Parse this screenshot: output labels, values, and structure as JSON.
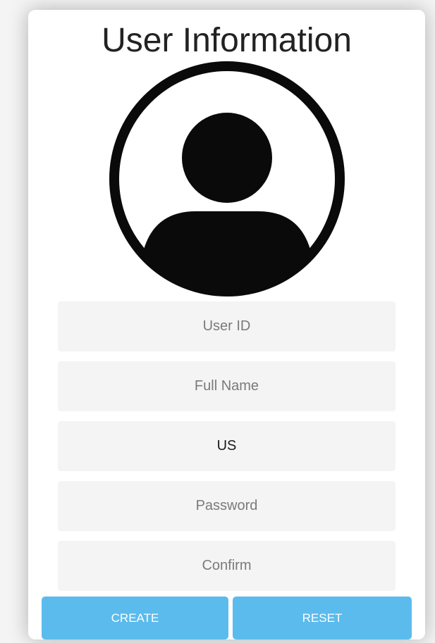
{
  "header": {
    "title": "User Information"
  },
  "avatar": {
    "icon": "user-avatar-icon"
  },
  "form": {
    "user_id": {
      "placeholder": "User ID",
      "value": ""
    },
    "full_name": {
      "placeholder": "Full Name",
      "value": ""
    },
    "country": {
      "placeholder": "",
      "value": "US"
    },
    "password": {
      "placeholder": "Password",
      "value": ""
    },
    "confirm": {
      "placeholder": "Confirm",
      "value": ""
    }
  },
  "actions": {
    "create_label": "CREATE",
    "reset_label": "RESET"
  },
  "colors": {
    "accent": "#5bbbec",
    "field_bg": "#f4f4f4",
    "title": "#222222"
  }
}
